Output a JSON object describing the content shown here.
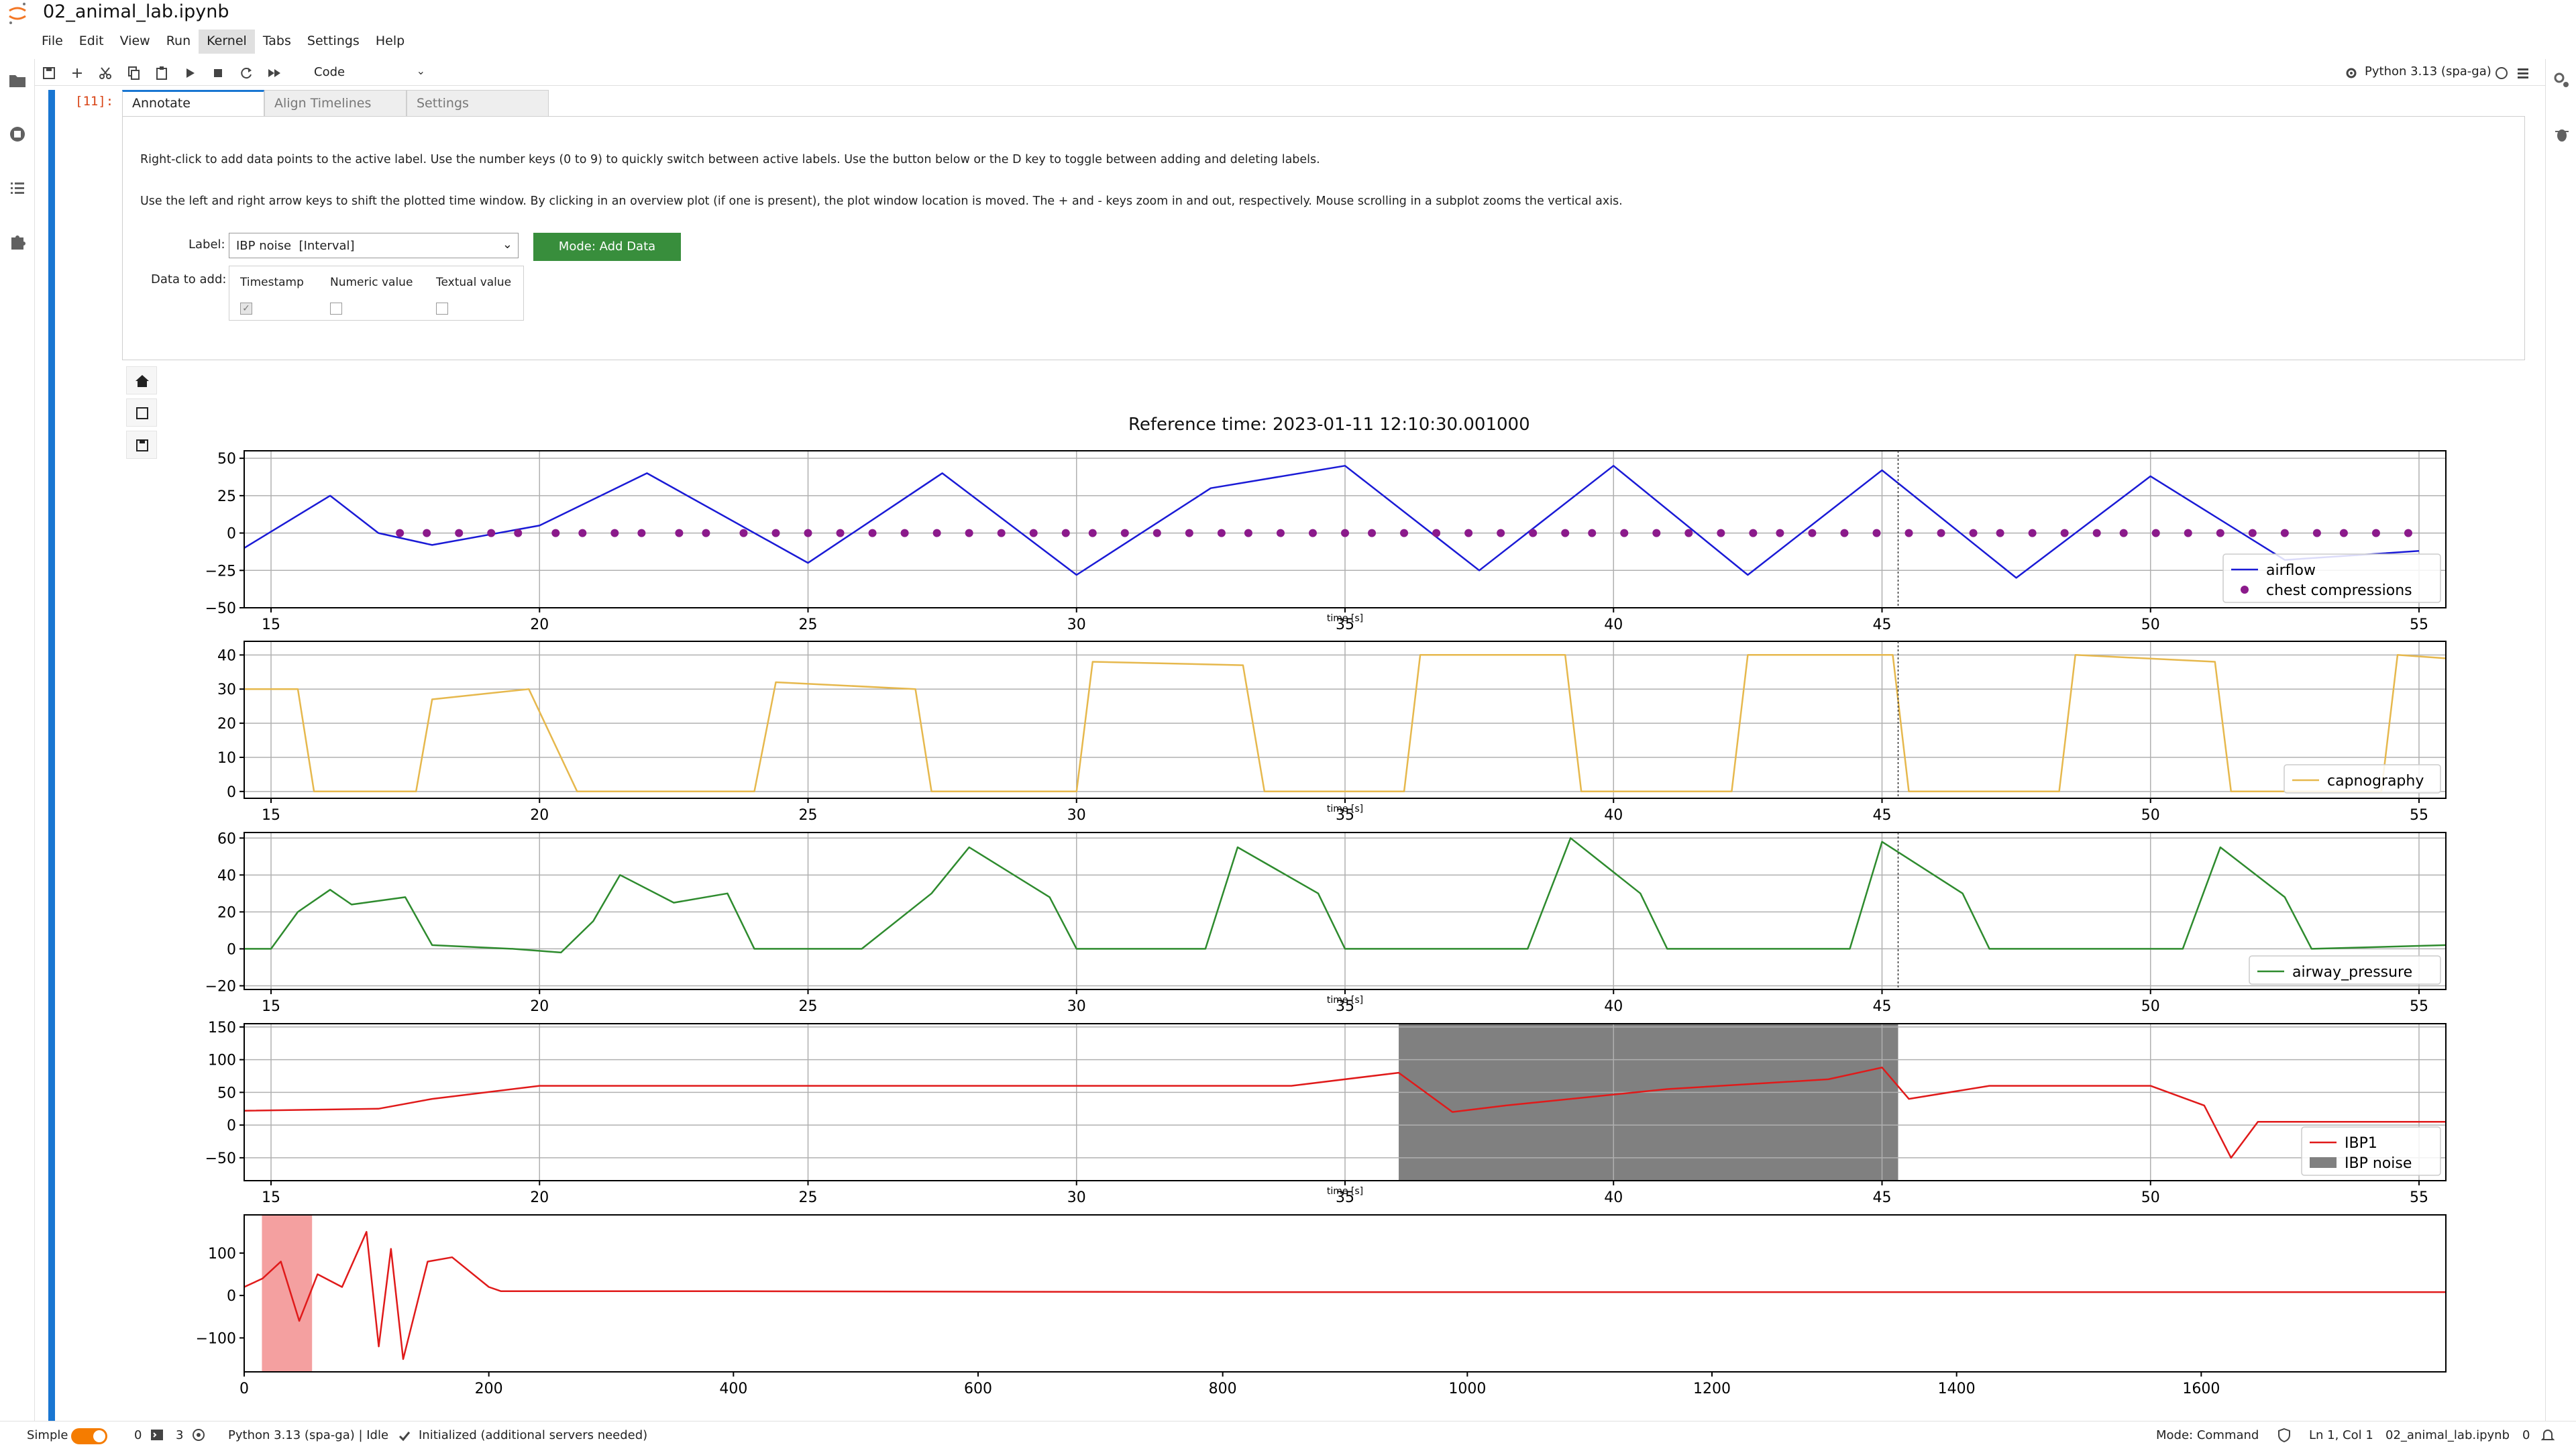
{
  "app": {
    "document_title": "02_animal_lab.ipynb"
  },
  "menu": [
    "File",
    "Edit",
    "View",
    "Run",
    "Kernel",
    "Tabs",
    "Settings",
    "Help"
  ],
  "menu_active": "Kernel",
  "toolbar": {
    "cell_type": "Code",
    "kernel_name": "Python 3.13 (spa-ga)",
    "icons": [
      "save-icon",
      "add-cell-icon",
      "cut-icon",
      "copy-icon",
      "paste-icon",
      "run-icon",
      "stop-icon",
      "restart-icon",
      "fast-forward-icon"
    ]
  },
  "cell": {
    "prompt": "[11]:"
  },
  "tabs": [
    "Annotate",
    "Align Timelines",
    "Settings"
  ],
  "annotate": {
    "instructions_1": "Right-click to add data points to the active label. Use the number keys (0 to 9) to quickly switch between active labels. Use the button below or the D key to toggle between adding and deleting labels.",
    "instructions_2": "Use the left and right arrow keys to shift the plotted time window. By clicking in an overview plot (if one is present), the plot window location is moved. The + and - keys zoom in and out, respectively. Mouse scrolling in a subplot zooms the vertical axis.",
    "label_caption": "Label:",
    "label_value": "IBP noise  [Interval]",
    "mode_button": "Mode: Add Data",
    "data_to_add_caption": "Data to add:",
    "checkboxes": [
      {
        "label": "Timestamp",
        "checked": true
      },
      {
        "label": "Numeric value",
        "checked": false
      },
      {
        "label": "Textual value",
        "checked": false
      }
    ]
  },
  "figure": {
    "title": "Reference time: 2023-01-11 12:10:30.001000"
  },
  "chart_data": [
    {
      "type": "line",
      "xlabel": "time [s]",
      "xlim": [
        14.5,
        55.5
      ],
      "ylim": [
        -50,
        55
      ],
      "x_ticks": [
        15,
        20,
        25,
        30,
        35,
        40,
        45,
        50,
        55
      ],
      "y_ticks": [
        -50,
        -25,
        0,
        25,
        50
      ],
      "grid": true,
      "legend_position": "bottom-right",
      "series": [
        {
          "name": "airflow",
          "color": "#1a1ad6",
          "kind": "line",
          "x": [
            14.5,
            16.1,
            17.0,
            18.0,
            20.0,
            22.0,
            25.0,
            27.5,
            30.0,
            32.5,
            35.0,
            37.5,
            40.0,
            42.5,
            45.0,
            47.5,
            50.0,
            52.5,
            55.0
          ],
          "y": [
            -10,
            25,
            0,
            -8,
            5,
            40,
            -20,
            40,
            -28,
            30,
            45,
            -25,
            45,
            -28,
            42,
            -30,
            38,
            -18,
            -12
          ]
        },
        {
          "name": "chest compressions",
          "color": "#8b1a8b",
          "kind": "markers",
          "x": [
            17.4,
            17.9,
            18.5,
            19.1,
            19.6,
            20.3,
            20.8,
            21.4,
            21.9,
            22.6,
            23.1,
            23.8,
            24.4,
            25.0,
            25.6,
            26.2,
            26.8,
            27.4,
            28.0,
            28.6,
            29.2,
            29.8,
            30.3,
            30.9,
            31.5,
            32.1,
            32.7,
            33.2,
            33.8,
            34.4,
            35.0,
            35.5,
            36.1,
            36.7,
            37.3,
            37.9,
            38.5,
            39.1,
            39.6,
            40.2,
            40.8,
            41.4,
            42.0,
            42.6,
            43.1,
            43.7,
            44.3,
            44.9,
            45.5,
            46.1,
            46.7,
            47.2,
            47.8,
            48.4,
            49.0,
            49.5,
            50.1,
            50.7,
            51.3,
            51.9,
            52.5,
            53.1,
            53.6,
            54.2,
            54.8
          ],
          "y": [
            0,
            0,
            0,
            0,
            0,
            0,
            0,
            0,
            0,
            0,
            0,
            0,
            0,
            0,
            0,
            0,
            0,
            0,
            0,
            0,
            0,
            0,
            0,
            0,
            0,
            0,
            0,
            0,
            0,
            0,
            0,
            0,
            0,
            0,
            0,
            0,
            0,
            0,
            0,
            0,
            0,
            0,
            0,
            0,
            0,
            0,
            0,
            0,
            0,
            0,
            0,
            0,
            0,
            0,
            0,
            0,
            0,
            0,
            0,
            0,
            0,
            0,
            0,
            0,
            0
          ]
        }
      ]
    },
    {
      "type": "line",
      "xlabel": "time [s]",
      "xlim": [
        14.5,
        55.5
      ],
      "ylim": [
        -2,
        44
      ],
      "x_ticks": [
        15,
        20,
        25,
        30,
        35,
        40,
        45,
        50,
        55
      ],
      "y_ticks": [
        0,
        10,
        20,
        30,
        40
      ],
      "grid": true,
      "legend_position": "bottom-right",
      "series": [
        {
          "name": "capnography",
          "color": "#e6b84d",
          "x": [
            14.5,
            15.5,
            15.8,
            17.7,
            18.0,
            19.8,
            20.7,
            21.0,
            24.0,
            24.4,
            27.0,
            27.3,
            30.0,
            30.3,
            33.1,
            33.5,
            36.1,
            36.4,
            39.1,
            39.4,
            42.2,
            42.5,
            45.2,
            45.5,
            48.3,
            48.6,
            51.2,
            51.5,
            54.3,
            54.6,
            55.5
          ],
          "y": [
            30,
            30,
            0,
            0,
            27,
            30,
            0,
            0,
            0,
            32,
            30,
            0,
            0,
            38,
            37,
            0,
            0,
            40,
            40,
            0,
            0,
            40,
            40,
            0,
            0,
            40,
            38,
            0,
            0,
            40,
            39
          ]
        }
      ]
    },
    {
      "type": "line",
      "xlabel": "time [s]",
      "xlim": [
        14.5,
        55.5
      ],
      "ylim": [
        -22,
        63
      ],
      "x_ticks": [
        15,
        20,
        25,
        30,
        35,
        40,
        45,
        50,
        55
      ],
      "y_ticks": [
        -20,
        0,
        20,
        40,
        60
      ],
      "grid": true,
      "legend_position": "bottom-right",
      "series": [
        {
          "name": "airway_pressure",
          "color": "#2e8b2e",
          "x": [
            14.5,
            15.0,
            15.5,
            16.1,
            16.5,
            17.5,
            18.0,
            19.5,
            20.4,
            21.0,
            21.5,
            22.5,
            23.5,
            24.0,
            26.0,
            27.3,
            28.0,
            29.5,
            30.0,
            32.4,
            33.0,
            34.5,
            35.0,
            38.4,
            39.2,
            40.5,
            41.0,
            44.4,
            45.0,
            46.5,
            47.0,
            50.6,
            51.3,
            52.5,
            53.0,
            55.5
          ],
          "y": [
            0,
            0,
            20,
            32,
            24,
            28,
            2,
            0,
            -2,
            15,
            40,
            25,
            30,
            0,
            0,
            30,
            55,
            28,
            0,
            0,
            55,
            30,
            0,
            0,
            60,
            30,
            0,
            0,
            58,
            30,
            0,
            0,
            55,
            28,
            0,
            2
          ]
        }
      ]
    },
    {
      "type": "line",
      "xlabel": "time [s]",
      "xlim": [
        14.5,
        55.5
      ],
      "ylim": [
        -85,
        155
      ],
      "x_ticks": [
        15,
        20,
        25,
        30,
        35,
        40,
        45,
        50,
        55
      ],
      "y_ticks": [
        -50,
        0,
        50,
        100,
        150
      ],
      "grid": true,
      "legend_position": "bottom-right",
      "series": [
        {
          "name": "IBP1",
          "color": "#e01a1a",
          "x": [
            14.5,
            17.0,
            18.0,
            20.0,
            25.0,
            30.0,
            34.0,
            36.0,
            37.0,
            38.0,
            41.0,
            44.0,
            45.0,
            45.5,
            47.0,
            50.0,
            51.0,
            51.5,
            52.0,
            55.5
          ],
          "y": [
            22,
            25,
            40,
            60,
            60,
            60,
            60,
            80,
            20,
            30,
            55,
            70,
            88,
            40,
            60,
            60,
            30,
            -50,
            5,
            5
          ]
        }
      ],
      "annotations": [
        {
          "name": "IBP noise",
          "kind": "interval",
          "x_start": 36.0,
          "x_end": 45.3,
          "color": "#808080"
        }
      ]
    },
    {
      "type": "line",
      "xlim": [
        0,
        1800
      ],
      "ylim": [
        -180,
        190
      ],
      "x_ticks": [
        0,
        200,
        400,
        600,
        800,
        1000,
        1200,
        1400,
        1600
      ],
      "y_ticks": [
        -100,
        0,
        100
      ],
      "grid": false,
      "series": [
        {
          "color": "#e01a1a",
          "x": [
            0,
            15,
            30,
            45,
            60,
            80,
            100,
            110,
            120,
            130,
            150,
            170,
            200,
            210,
            400,
            800,
            1200,
            1800
          ],
          "y": [
            20,
            40,
            80,
            -60,
            50,
            20,
            150,
            -120,
            110,
            -150,
            80,
            90,
            20,
            10,
            10,
            8,
            8,
            8
          ]
        }
      ],
      "annotations": [
        {
          "kind": "window",
          "x_start": 14.5,
          "x_end": 55.5,
          "color": "#f4a0a0"
        }
      ]
    }
  ],
  "statusbar": {
    "simple_label": "Simple",
    "terminals": "0",
    "kernels": "3",
    "kernel_status": "Python 3.13 (spa-ga) | Idle",
    "lsp_status": "Initialized (additional servers needed)",
    "mode": "Mode: Command",
    "cursor": "Ln 1, Col 1",
    "file_name": "02_animal_lab.ipynb",
    "notifications": "0"
  }
}
